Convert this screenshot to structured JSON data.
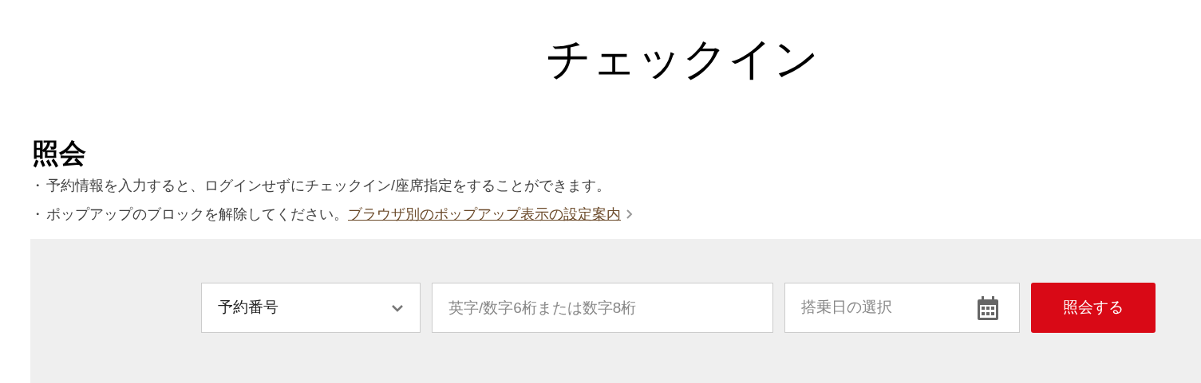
{
  "page_title": "チェックイン",
  "section": {
    "heading": "照会",
    "bullet": "・",
    "notes": [
      {
        "text": "予約情報を入力すると、ログインせずにチェックイン/座席指定をすることができます。"
      },
      {
        "text": "ポップアップのブロックを解除してください。",
        "link": "ブラウザ別のポップアップ表示の設定案内"
      }
    ]
  },
  "search": {
    "type_select": {
      "value": "予約番号"
    },
    "number_field": {
      "placeholder": "英字/数字6桁または数字8桁"
    },
    "date_field": {
      "placeholder": "搭乗日の選択"
    },
    "submit": "照会する"
  }
}
